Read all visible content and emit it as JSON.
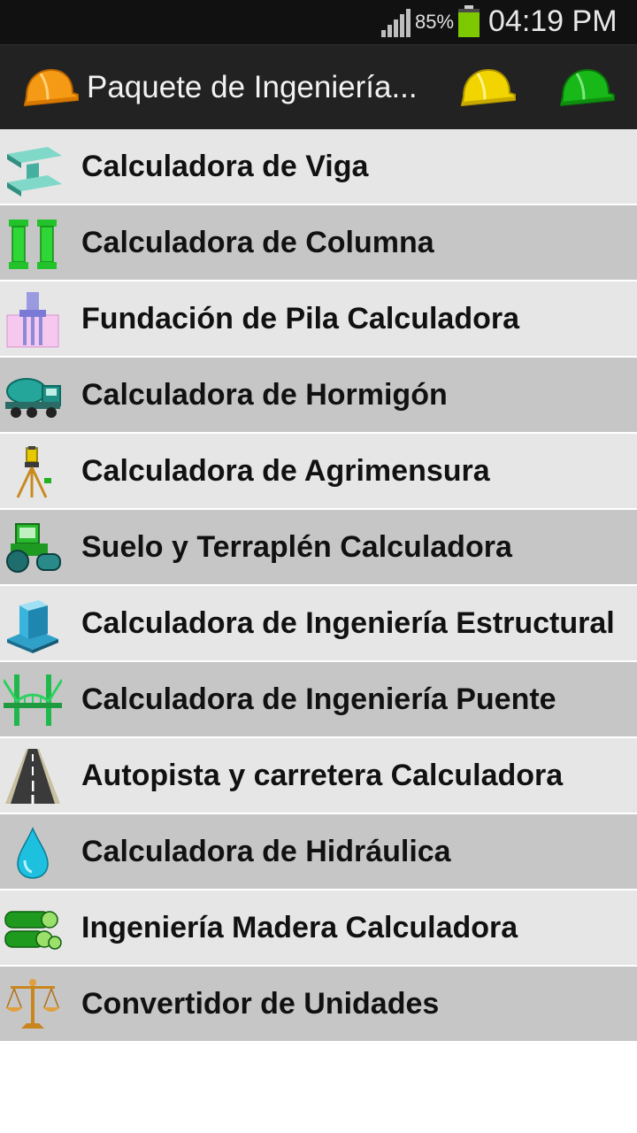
{
  "status_bar": {
    "battery_percent": "85%",
    "time": "04:19 PM",
    "battery_level": 0.85
  },
  "action_bar": {
    "title": "Paquete de Ingeniería...",
    "app_icon": "orange-hard-hat-icon",
    "actions": [
      {
        "icon": "yellow-hard-hat-icon",
        "color": "#f2d400"
      },
      {
        "icon": "green-hard-hat-icon",
        "color": "#18b818"
      }
    ]
  },
  "colors": {
    "status_bar_bg": "#111111",
    "action_bar_bg": "#222222",
    "row_light": "#e6e6e6",
    "row_dark": "#c6c6c6"
  },
  "menu": [
    {
      "label": "Calculadora de Viga",
      "icon": "steel-beam-icon"
    },
    {
      "label": "Calculadora de Columna",
      "icon": "column-icon"
    },
    {
      "label": "Fundación de Pila Calculadora",
      "icon": "pile-foundation-icon"
    },
    {
      "label": "Calculadora de Hormigón",
      "icon": "concrete-mixer-truck-icon"
    },
    {
      "label": "Calculadora de Agrimensura",
      "icon": "surveyor-tripod-icon"
    },
    {
      "label": "Suelo y Terraplén Calculadora",
      "icon": "road-roller-icon"
    },
    {
      "label": "Calculadora de Ingeniería Estructural",
      "icon": "building-block-icon"
    },
    {
      "label": "Calculadora de Ingeniería Puente",
      "icon": "bridge-icon"
    },
    {
      "label": "Autopista y carretera Calculadora",
      "icon": "highway-icon"
    },
    {
      "label": "Calculadora de Hidráulica",
      "icon": "water-drop-icon"
    },
    {
      "label": "Ingeniería Madera Calculadora",
      "icon": "timber-logs-icon"
    },
    {
      "label": "Convertidor de Unidades",
      "icon": "balance-scale-icon"
    }
  ]
}
